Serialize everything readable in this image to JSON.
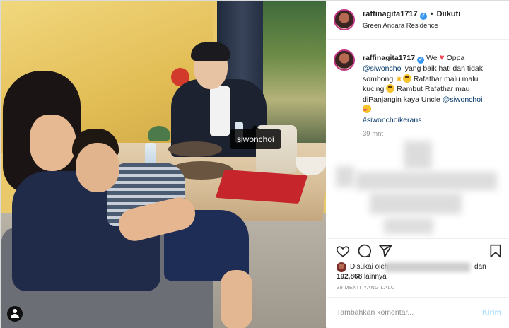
{
  "post": {
    "username": "raffinagita1717",
    "follow_sep": "•",
    "follow_state": "Diikuti",
    "location": "Green Andara Residence",
    "photo_tag": "siwonchoi"
  },
  "caption": {
    "username": "raffinagita1717",
    "w1": "We",
    "w2": "Oppa",
    "mention1": "@siwonchoi",
    "w3": "yang baik hati dan tidak sombong",
    "w4": "Rafathar malu malu kucing",
    "w5": "Rambut Rafathar mau diPanjangin kaya Uncle",
    "mention2": "@siwonchoi",
    "hashtag": "#siwonchoikerans",
    "time": "39 mnt"
  },
  "icons": {
    "heart": "heart-outline-icon",
    "comment": "comment-bubble-icon",
    "share": "paper-plane-icon",
    "save": "bookmark-icon",
    "verified": "verified-badge-icon",
    "tagged_users": "user-icon"
  },
  "likes": {
    "prefix": "Disukai oleh",
    "and": "dan",
    "count": "192,868",
    "suffix": "lainnya"
  },
  "timestamp": "39 MENIT YANG LALU",
  "comment_box": {
    "placeholder": "Tambahkan komentar...",
    "submit": "Kirim"
  },
  "colors": {
    "link": "#003569",
    "verified": "#3897f0",
    "submit_disabled": "#b2dffc",
    "like_heart": "#ed4956"
  }
}
